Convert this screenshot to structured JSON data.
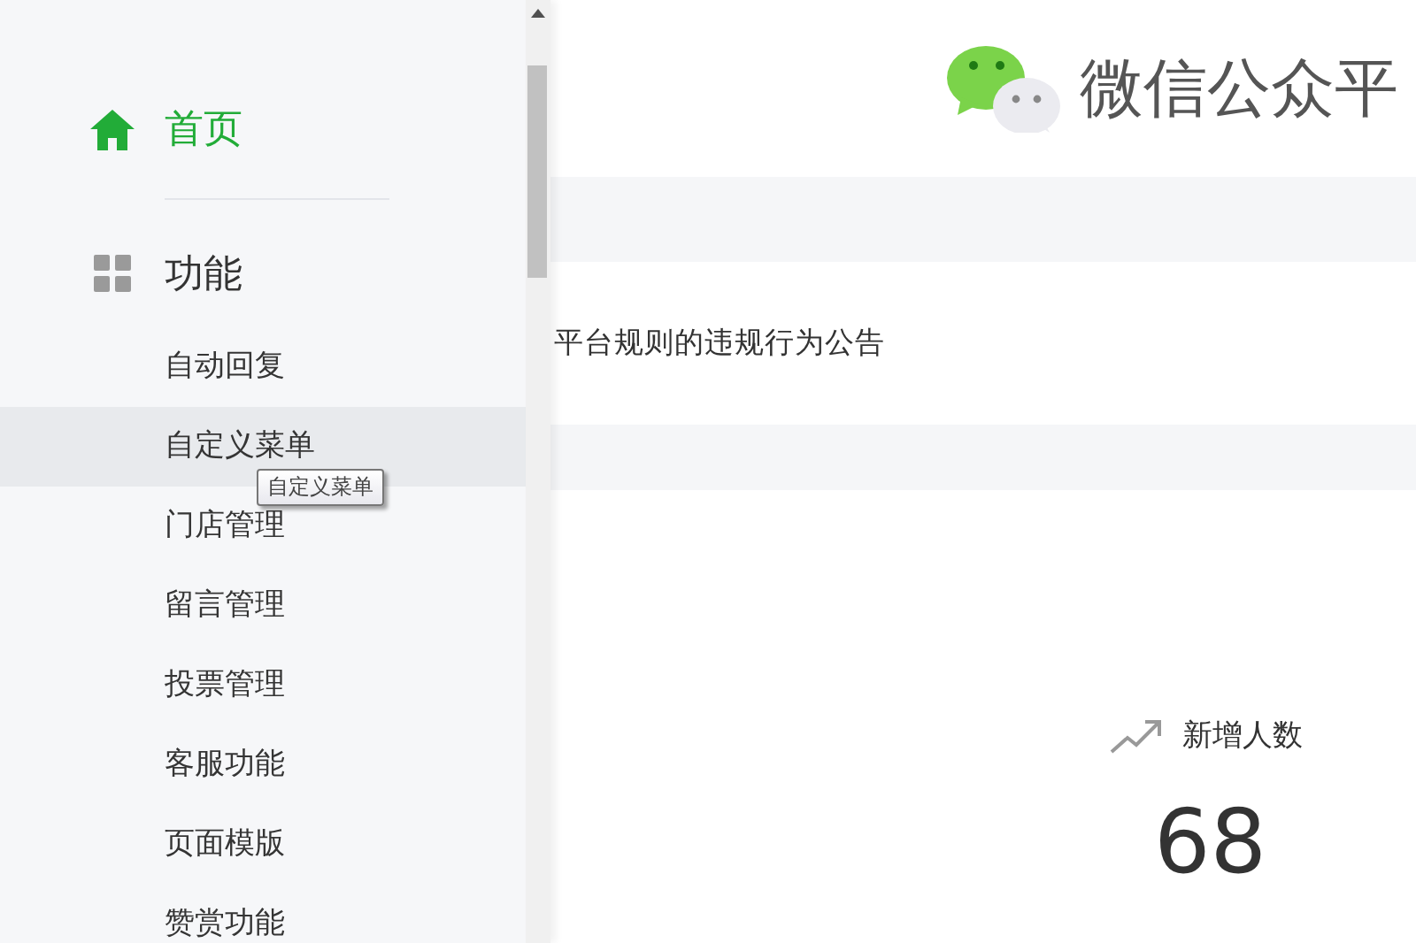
{
  "sidebar": {
    "home": {
      "label": "首页",
      "selected": true
    },
    "section": {
      "label": "功能"
    },
    "items": [
      {
        "label": "自动回复",
        "hovered": false
      },
      {
        "label": "自定义菜单",
        "hovered": true
      },
      {
        "label": "门店管理",
        "hovered": false
      },
      {
        "label": "留言管理",
        "hovered": false
      },
      {
        "label": "投票管理",
        "hovered": false
      },
      {
        "label": "客服功能",
        "hovered": false
      },
      {
        "label": "页面模版",
        "hovered": false
      },
      {
        "label": "赞赏功能",
        "hovered": false
      }
    ],
    "tooltip": "自定义菜单"
  },
  "header": {
    "title": "微信公众平"
  },
  "notice": {
    "text": "平台规则的违规行为公告"
  },
  "stats": [
    {
      "label": "新增人数",
      "value": "68"
    }
  ]
}
